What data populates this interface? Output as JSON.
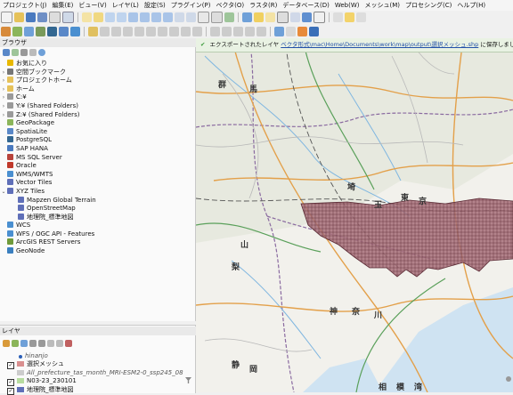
{
  "menubar": [
    "プロジェクト(J)",
    "編集(E)",
    "ビュー(V)",
    "レイヤ(L)",
    "設定(S)",
    "プラグイン(P)",
    "ベクタ(O)",
    "ラスタ(R)",
    "データベース(D)",
    "Web(W)",
    "メッシュ(M)",
    "プロセシング(C)",
    "ヘルプ(H)"
  ],
  "browser": {
    "title": "ブラウザ",
    "items": [
      {
        "label": "お気に入り",
        "icon": "star-icon",
        "color": "#e8b800",
        "expand": ""
      },
      {
        "label": "空間ブックマーク",
        "icon": "bookmark-icon",
        "color": "#777777",
        "expand": "›"
      },
      {
        "label": "プロジェクトホーム",
        "icon": "folder-icon",
        "color": "#e6c25a",
        "expand": "›"
      },
      {
        "label": "ホーム",
        "icon": "folder-icon",
        "color": "#e6c25a",
        "expand": "›"
      },
      {
        "label": "C:¥",
        "icon": "drive-icon",
        "color": "#9a9a9a",
        "expand": "›"
      },
      {
        "label": "Y:¥ (Shared Folders)",
        "icon": "drive-icon",
        "color": "#9a9a9a",
        "expand": "›"
      },
      {
        "label": "Z:¥ (Shared Folders)",
        "icon": "drive-icon",
        "color": "#9a9a9a",
        "expand": "›"
      },
      {
        "label": "GeoPackage",
        "icon": "geopackage-icon",
        "color": "#8bb55a",
        "expand": ""
      },
      {
        "label": "SpatiaLite",
        "icon": "spatialite-icon",
        "color": "#5a88c8",
        "expand": ""
      },
      {
        "label": "PostgreSQL",
        "icon": "postgresql-icon",
        "color": "#336791",
        "expand": ""
      },
      {
        "label": "SAP HANA",
        "icon": "database-icon",
        "color": "#4a7abf",
        "expand": ""
      },
      {
        "label": "MS SQL Server",
        "icon": "database-icon",
        "color": "#b8433b",
        "expand": ""
      },
      {
        "label": "Oracle",
        "icon": "database-icon",
        "color": "#c0392b",
        "expand": ""
      },
      {
        "label": "WMS/WMTS",
        "icon": "globe-icon",
        "color": "#4a8fd0",
        "expand": ""
      },
      {
        "label": "Vector Tiles",
        "icon": "grid-icon",
        "color": "#5f6fb8",
        "expand": ""
      },
      {
        "label": "XYZ Tiles",
        "icon": "grid-icon",
        "color": "#5f6fb8",
        "expand": "⌄"
      },
      {
        "label": "Mapzen Global Terrain",
        "icon": "grid-icon",
        "color": "#5f6fb8",
        "expand": "",
        "indent": true
      },
      {
        "label": "OpenStreetMap",
        "icon": "grid-icon",
        "color": "#5f6fb8",
        "expand": "",
        "indent": true
      },
      {
        "label": "地理院_標準地図",
        "icon": "grid-icon",
        "color": "#5f6fb8",
        "expand": "",
        "indent": true
      },
      {
        "label": "WCS",
        "icon": "globe-icon",
        "color": "#4a8fd0",
        "expand": ""
      },
      {
        "label": "WFS / OGC API - Features",
        "icon": "globe-icon",
        "color": "#4a8fd0",
        "expand": ""
      },
      {
        "label": "ArcGIS REST Servers",
        "icon": "globe-icon",
        "color": "#6f9a3a",
        "expand": ""
      },
      {
        "label": "GeoNode",
        "icon": "geonode-icon",
        "color": "#3a7fbf",
        "expand": ""
      }
    ]
  },
  "layers": {
    "title": "レイヤ",
    "items": [
      {
        "label": "hinanjo",
        "checked": "",
        "italic": true,
        "swatch": "#2b5fb8",
        "visible_cb": false
      },
      {
        "label": "選択メッシュ",
        "checked": "✓",
        "italic": false,
        "swatch": "#d98f8f",
        "visible_cb": true
      },
      {
        "label": "All_prefecture_tas_month_MRI-ESM2-0_ssp245_08",
        "checked": "",
        "italic": true,
        "swatch": "#cccccc",
        "visible_cb": false
      },
      {
        "label": "N03-23_230101",
        "checked": "✓",
        "italic": false,
        "swatch": "#b7dca0",
        "visible_cb": true
      },
      {
        "label": "地理院_標準地図",
        "checked": "✓",
        "italic": false,
        "swatch": "#5f6fb8",
        "visible_cb": true
      }
    ]
  },
  "message": {
    "prefix": "エクスポートされたレイヤ",
    "link": "ベクタ形式\\mac\\Home\\Documents\\work\\map\\output\\選択メッシュ.shp",
    "suffix": "に保存しました"
  },
  "map_labels": [
    "群",
    "馬",
    "埼",
    "玉",
    "東",
    "京",
    "山",
    "梨",
    "神",
    "奈",
    "川",
    "静",
    "岡",
    "相",
    "模",
    "湾"
  ],
  "colors": {
    "mesh_fill": "#a8707a",
    "mesh_line": "#5a2a34",
    "msg_bg": "#e9f2e3"
  }
}
